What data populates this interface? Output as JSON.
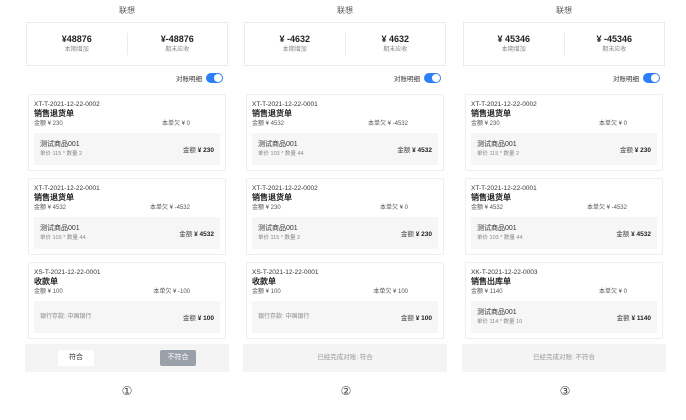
{
  "screens": [
    {
      "title": "联想",
      "summary": {
        "increase_value": "¥48876",
        "increase_label": "本期增加",
        "receive_value": "¥-48876",
        "receive_label": "期末应收"
      },
      "toggle_label": "对账明细",
      "cards": [
        {
          "code": "XT-T-2021-12-22-0002",
          "name": "销售退货单",
          "amount": "金额 ¥ 230",
          "outstanding": "本单欠 ¥ 0",
          "product": "测试商品001",
          "meta": "单价 115 * 数量 2",
          "line_amount_label": "金额",
          "line_amount": "¥ 230"
        },
        {
          "code": "XT-T-2021-12-22-0001",
          "name": "销售退货单",
          "amount": "金额 ¥ 4532",
          "outstanding": "本单欠 ¥ -4532",
          "product": "测试商品001",
          "meta": "单价 103 * 数量 44",
          "line_amount_label": "金额",
          "line_amount": "¥ 4532"
        },
        {
          "code": "XS-T-2021-12-22-0001",
          "name": "收款单",
          "amount": "金额 ¥ 100",
          "outstanding": "本单欠 ¥ -100",
          "product": "银行存款: 中国银行",
          "meta": "",
          "line_amount_label": "金额",
          "line_amount": "¥ 100"
        }
      ],
      "footer": {
        "confirm": "符合",
        "reject": "不符合"
      }
    },
    {
      "title": "联想",
      "summary": {
        "increase_value": "¥ -4632",
        "increase_label": "本期增加",
        "receive_value": "¥ 4632",
        "receive_label": "期末应收"
      },
      "toggle_label": "对账明细",
      "cards": [
        {
          "code": "XT-T-2021-12-22-0001",
          "name": "销售退货单",
          "amount": "金额 ¥ 4532",
          "outstanding": "本单欠 ¥ -4532",
          "product": "测试商品001",
          "meta": "单价 103 * 数量 44",
          "line_amount_label": "金额",
          "line_amount": "¥ 4532"
        },
        {
          "code": "XT-T-2021-12-22-0002",
          "name": "销售退货单",
          "amount": "金额 ¥ 230",
          "outstanding": "本单欠 ¥ 0",
          "product": "测试商品001",
          "meta": "单价 115 * 数量 2",
          "line_amount_label": "金额",
          "line_amount": "¥ 230"
        },
        {
          "code": "XS-T-2021-12-22-0001",
          "name": "收款单",
          "amount": "金额 ¥ 100",
          "outstanding": "本单欠 ¥ 100",
          "product": "银行存款: 中国银行",
          "meta": "",
          "line_amount_label": "金额",
          "line_amount": "¥ 100"
        }
      ],
      "status": "已经完成对账: 符合"
    },
    {
      "title": "联想",
      "summary": {
        "increase_value": "¥ 45346",
        "increase_label": "本期增加",
        "receive_value": "¥ -45346",
        "receive_label": "期末应收"
      },
      "toggle_label": "对账明细",
      "cards": [
        {
          "code": "XT-T-2021-12-22-0002",
          "name": "销售退货单",
          "amount": "金额 ¥ 230",
          "outstanding": "本单欠 ¥ 0",
          "product": "测试商品001",
          "meta": "单价 115 * 数量 2",
          "line_amount_label": "金额",
          "line_amount": "¥ 230"
        },
        {
          "code": "XT-T-2021-12-22-0001",
          "name": "销售退货单",
          "amount": "金额 ¥ 4532",
          "outstanding": "本单欠 ¥ -4532",
          "product": "测试商品001",
          "meta": "单价 103 * 数量 44",
          "line_amount_label": "金额",
          "line_amount": "¥ 4532"
        },
        {
          "code": "XK-T-2021-12-22-0003",
          "name": "销售出库单",
          "amount": "金额 ¥ 1140",
          "outstanding": "本单欠 ¥ 0",
          "product": "测试商品001",
          "meta": "单价 114 * 数量 10",
          "line_amount_label": "金额",
          "line_amount": "¥ 1140"
        }
      ],
      "status": "已经完成对账: 不符合"
    }
  ],
  "markers": [
    "①",
    "②",
    "③"
  ]
}
